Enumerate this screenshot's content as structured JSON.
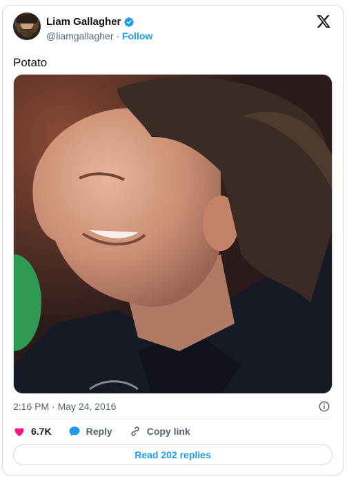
{
  "author": {
    "display_name": "Liam Gallagher",
    "handle": "@liamgallagher",
    "separator": "·",
    "follow_label": "Follow"
  },
  "tweet": {
    "text": "Potato",
    "timestamp": "2:16 PM · May 24, 2016"
  },
  "actions": {
    "likes": "6.7K",
    "reply_label": "Reply",
    "copy_link_label": "Copy link"
  },
  "read_replies_label": "Read 202 replies",
  "colors": {
    "accent": "#1d9bf0",
    "like": "#f91880",
    "muted": "#536471",
    "border": "#cfd9de"
  },
  "icons": [
    "verified-badge-icon",
    "x-logo-icon",
    "info-icon",
    "heart-icon",
    "reply-icon",
    "link-icon"
  ]
}
